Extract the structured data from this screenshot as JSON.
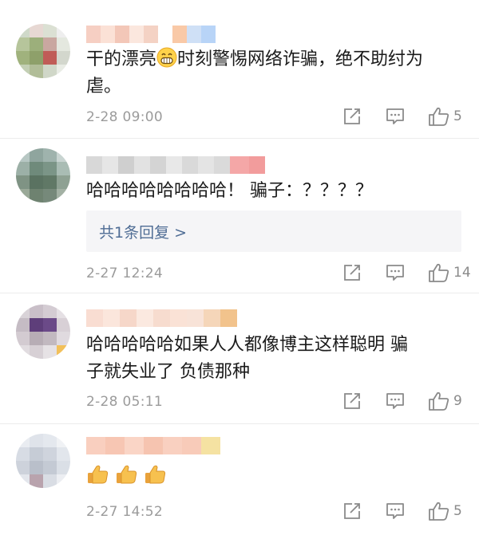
{
  "comments": [
    {
      "text_before_emoji": "干的漂亮",
      "emoji": "grinning-face-emoji",
      "text_after_emoji": "时刻警惕网络诈骗，绝不助纣为",
      "text_line2": "虐。",
      "time": "2-28 09:00",
      "likes": "5",
      "name_colors": [
        "#f6cfc3",
        "#fbe1d6",
        "#f3c7b8",
        "#fbe7de",
        "#f4d2c4",
        "#f9c9a7",
        "#cfe0f6",
        "#b8d4f7"
      ]
    },
    {
      "text": "哈哈哈哈哈哈哈哈！ 骗子：？？？？",
      "reply_label": "共1条回复 >",
      "time": "2-27 12:24",
      "likes": "14",
      "name_colors": [
        "#d8d8d8",
        "#e6e6e6",
        "#cfcfcf",
        "#e2e2e2",
        "#d4d4d4",
        "#e8e8e8",
        "#d9d9d9",
        "#f4a7a7",
        "#f29c9c"
      ]
    },
    {
      "text_line1": "哈哈哈哈哈如果人人都像博主这样聪明 骗",
      "text_line2": "子就失业了 负债那种",
      "time": "2-28 05:11",
      "likes": "9",
      "name_colors": [
        "#f9ddd2",
        "#fbe6dc",
        "#f6d7c9",
        "#fbe9e0",
        "#f7dccf",
        "#fae2d6",
        "#f8e3d8",
        "#f5d6b9",
        "#f2c38c"
      ]
    },
    {
      "emojis": [
        "thumbs-up-emoji",
        "thumbs-up-emoji",
        "thumbs-up-emoji"
      ],
      "time": "2-27 14:52",
      "likes": "5",
      "name_colors": [
        "#f9cfbf",
        "#f7c6b3",
        "#fad5c6",
        "#f6c4b0",
        "#f9d0c0",
        "#f8cbb9",
        "#f5e2a2"
      ]
    }
  ],
  "colors": {
    "link": "#4f6d95",
    "muted": "#9b9b9b",
    "icon": "#8a8a8a",
    "reply_bg": "#f5f5f7"
  }
}
